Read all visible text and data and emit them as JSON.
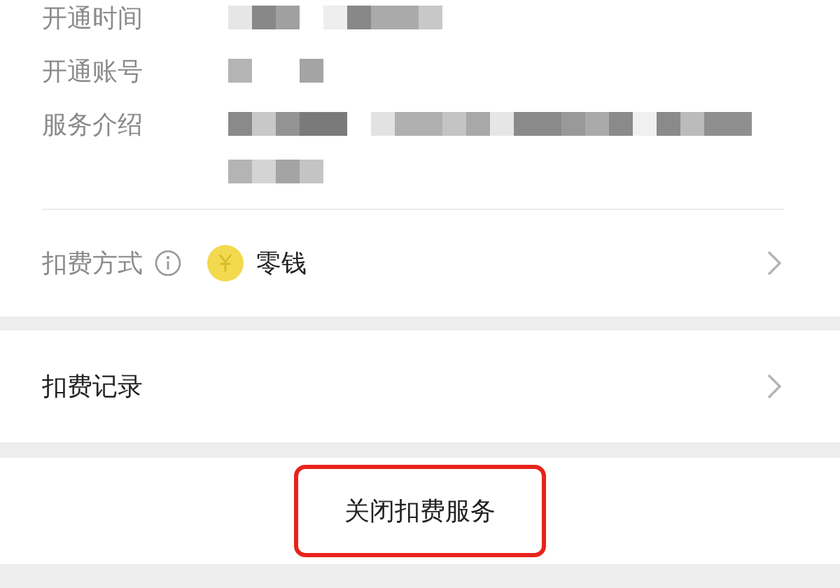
{
  "details": [
    {
      "label": "开通时间"
    },
    {
      "label": "开通账号"
    },
    {
      "label": "服务介绍"
    }
  ],
  "payment": {
    "label": "扣费方式",
    "method": "零钱"
  },
  "records": {
    "label": "扣费记录"
  },
  "close_button": {
    "label": "关闭扣费服务",
    "highlighted": true
  }
}
